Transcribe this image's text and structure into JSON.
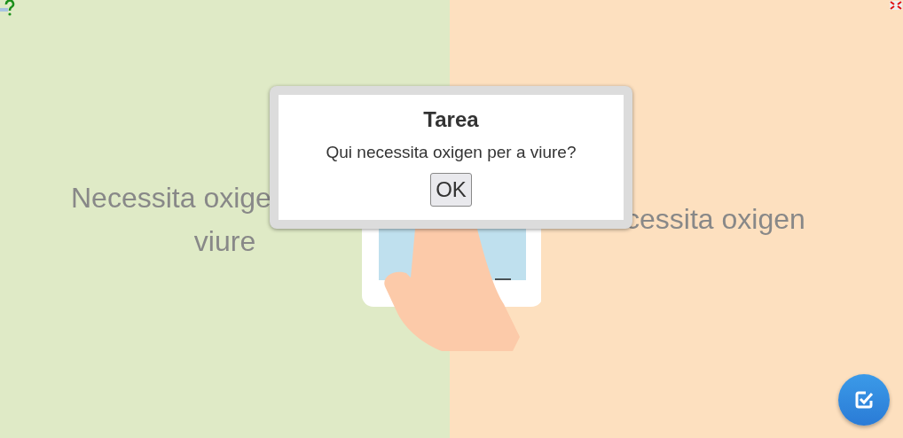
{
  "left_zone": {
    "lines": [
      "Necessita oxige",
      "viure"
    ]
  },
  "right_zone": {
    "label": "cessita oxigen"
  },
  "dialog": {
    "title": "Tarea",
    "message": "Qui necessita oxigen per a viure?",
    "button": "OK"
  }
}
